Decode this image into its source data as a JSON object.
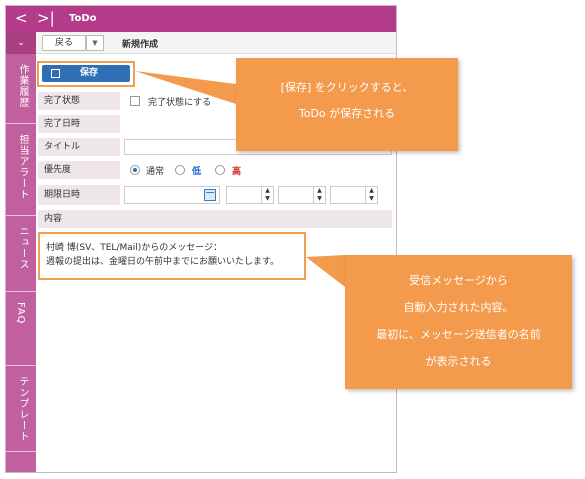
{
  "titlebar": {
    "back_glyph": "<",
    "forward_glyph": ">|",
    "title": "ToDo"
  },
  "sidebar": {
    "collapse_glyph": "⌄",
    "tabs": [
      "作業履歴",
      "担当アラート",
      "ニュース",
      "FAQ",
      "テンプレート"
    ]
  },
  "toolbar": {
    "back_label": "戻る",
    "dropdown_glyph": "▼",
    "page_title": "新規作成"
  },
  "form": {
    "save_label": "保存",
    "completion_status_label": "完了状態",
    "completion_checkbox_label": "完了状態にする",
    "completion_datetime_label": "完了日時",
    "title_label": "タイトル",
    "title_value": "",
    "priority_label": "優先度",
    "priority_options": [
      {
        "label": "通常",
        "color": "#333333",
        "selected": true
      },
      {
        "label": "低",
        "color": "#1e5bd0",
        "selected": false
      },
      {
        "label": "高",
        "color": "#d0261e",
        "selected": false
      }
    ],
    "due_label": "期限日時",
    "content_label": "内容",
    "message_lines": [
      "村崎 博(SV、TEL/Mail)からのメッセージ：",
      "週報の提出は、金曜日の午前中までにお願いいたします。"
    ]
  },
  "callouts": {
    "save": [
      "[保存] をクリックすると、",
      "ToDo が保存される"
    ],
    "message": [
      "受信メッセージから",
      "自動入力された内容。",
      "最初に、メッセージ送信者の名前",
      "が表示される"
    ]
  },
  "colors": {
    "titlebar": "#b33b8a",
    "sidebar": "#c0609e",
    "save_button": "#2f6fb3",
    "callout": "#f39a4c",
    "highlight": "#f0a050"
  }
}
